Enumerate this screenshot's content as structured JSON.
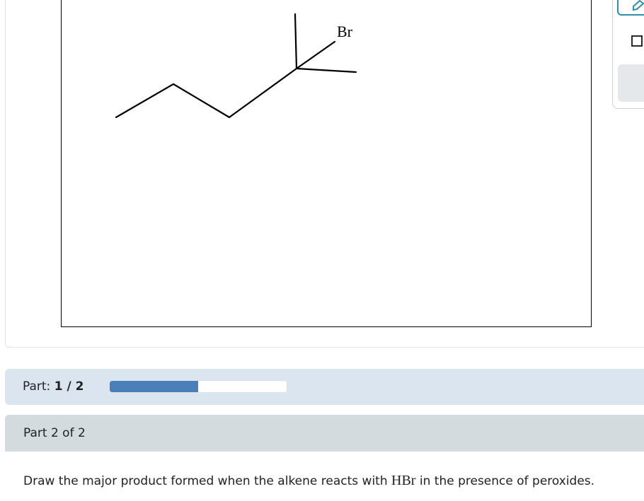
{
  "canvas": {
    "atom_label": "Br"
  },
  "toolbar": {
    "active_tool_icon": "pencil-icon",
    "square_tool_icon": "square-icon"
  },
  "part_progress": {
    "label": "Part:",
    "value": "1 / 2",
    "progress_fraction": 0.5,
    "fill_color": "#4a7fb8"
  },
  "section": {
    "title": "Part 2 of 2"
  },
  "question": {
    "text_before": "Draw the major product formed when the alkene reacts with ",
    "reagent": "HBr",
    "text_after": " in the presence of peroxides."
  }
}
